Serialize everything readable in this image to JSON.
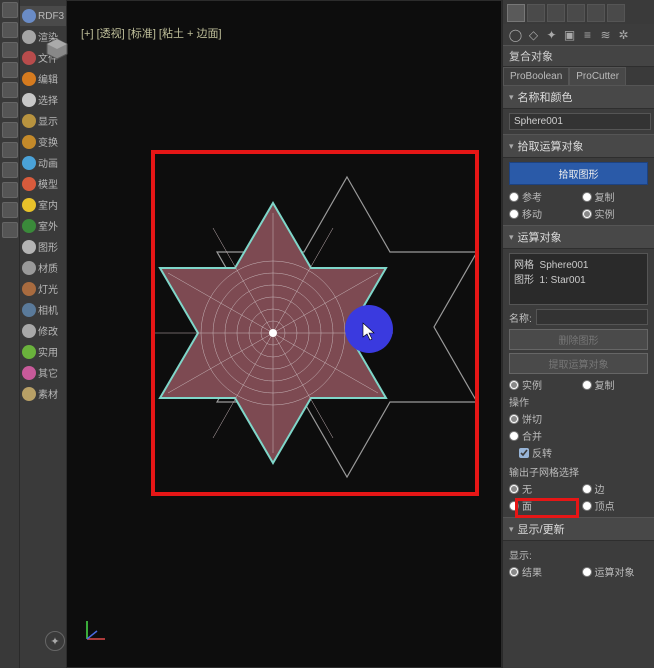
{
  "left_rail_icons": 12,
  "categories": [
    {
      "label": "RDF3",
      "color": "#6a8cc7"
    },
    {
      "label": "渲染",
      "color": "#a6a6a6"
    },
    {
      "label": "文件",
      "color": "#b84c4c"
    },
    {
      "label": "编辑",
      "color": "#d67b1f"
    },
    {
      "label": "选择",
      "color": "#c8c8c8"
    },
    {
      "label": "显示",
      "color": "#b8933f"
    },
    {
      "label": "变换",
      "color": "#c48a2a"
    },
    {
      "label": "动画",
      "color": "#4aa2d8"
    },
    {
      "label": "模型",
      "color": "#d85b3c"
    },
    {
      "label": "室内",
      "color": "#e8c22a"
    },
    {
      "label": "室外",
      "color": "#3a8a3a"
    },
    {
      "label": "图形",
      "color": "#b4b4b4"
    },
    {
      "label": "材质",
      "color": "#9a9a9a"
    },
    {
      "label": "灯光",
      "color": "#a86b3f"
    },
    {
      "label": "相机",
      "color": "#5a7a9a"
    },
    {
      "label": "修改",
      "color": "#a8a8a8"
    },
    {
      "label": "实用",
      "color": "#6ab23c"
    },
    {
      "label": "其它",
      "color": "#c85a9a"
    },
    {
      "label": "素材",
      "color": "#b8a066"
    }
  ],
  "viewport_label": "[+] [透视] [标准] [粘土 + 边面]",
  "command_panel": {
    "category_title": "复合对象",
    "sub_tabs": [
      "ProBoolean",
      "ProCutter"
    ],
    "active_tab": 0
  },
  "rollouts": {
    "name_color": {
      "title": "名称和颜色",
      "object_name": "Sphere001"
    },
    "pick_operand": {
      "title": "拾取运算对象",
      "pick_button": "拾取图形",
      "options": [
        "参考",
        "复制",
        "移动",
        "实例"
      ],
      "selected": 3
    },
    "operands": {
      "title": "运算对象",
      "list": [
        "网格  Sphere001",
        "图形  1: Star001"
      ],
      "name_label": "名称:",
      "delete_btn": "删除图形",
      "extract_btn": "提取运算对象",
      "extract_options": [
        "实例",
        "复制"
      ]
    },
    "operation": {
      "label": "操作",
      "options": [
        "饼切",
        "合并"
      ],
      "selected": 0,
      "inverse_label": "反转",
      "inverse_checked": true,
      "output_label": "输出子网格选择",
      "output_options": [
        "无",
        "边",
        "面",
        "顶点"
      ],
      "output_selected": 0
    },
    "display_update": {
      "title": "显示/更新",
      "display_label": "显示:",
      "display_options": [
        "结果",
        "运算对象"
      ],
      "display_selected": 0
    }
  }
}
